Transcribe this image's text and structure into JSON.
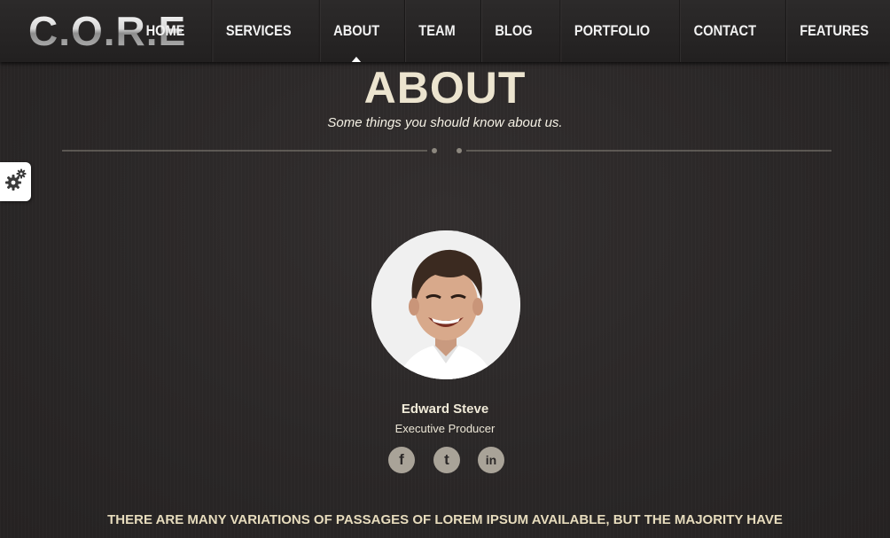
{
  "header": {
    "logo": "C.O.R.E",
    "nav": [
      {
        "label": "HOME",
        "active": false
      },
      {
        "label": "SERVICES",
        "active": false
      },
      {
        "label": "ABOUT",
        "active": true
      },
      {
        "label": "TEAM",
        "active": false
      },
      {
        "label": "BLOG",
        "active": false
      },
      {
        "label": "PORTFOLIO",
        "active": false
      },
      {
        "label": "CONTACT",
        "active": false
      },
      {
        "label": "FEATURES",
        "active": false
      }
    ]
  },
  "settings": {
    "icon": "gear-icon"
  },
  "section": {
    "title": "ABOUT",
    "subtitle": "Some things you should know about us."
  },
  "member": {
    "name": "Edward Steve",
    "role": "Executive Producer",
    "socials": [
      {
        "icon": "facebook-icon",
        "glyph": "f"
      },
      {
        "icon": "twitter-icon",
        "glyph": "t"
      },
      {
        "icon": "linkedin-icon",
        "glyph": "in"
      }
    ]
  },
  "body_text": "THERE ARE MANY VARIATIONS OF PASSAGES OF LOREM IPSUM AVAILABLE, BUT THE MAJORITY HAVE",
  "colors": {
    "background": "#2b2828",
    "heading": "#ece4cf",
    "social_bg": "#a9a398",
    "header_bg": "#252323"
  }
}
